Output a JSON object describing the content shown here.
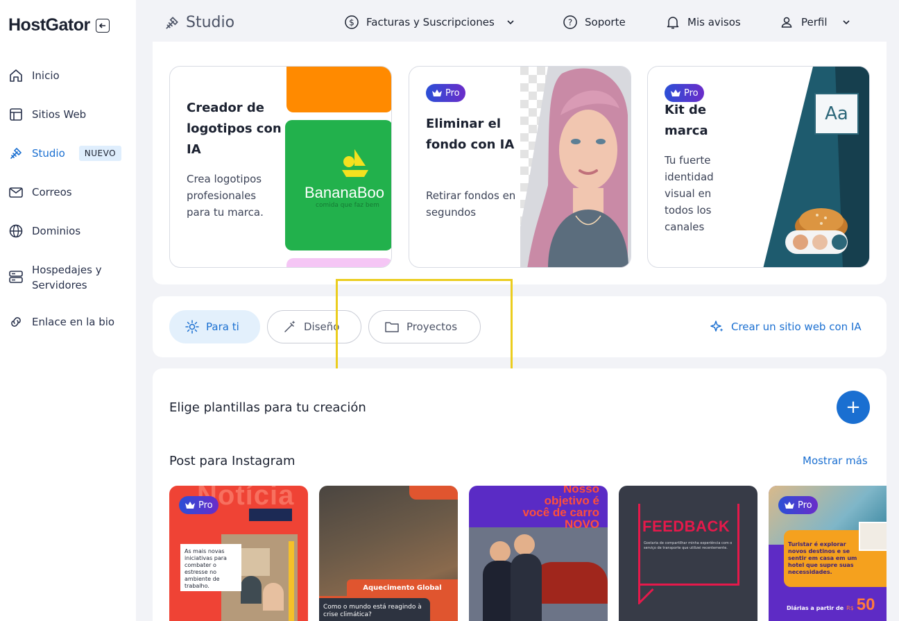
{
  "brand": {
    "logo": "HostGator"
  },
  "sidebar": {
    "items": [
      {
        "label": "Inicio",
        "icon": "home-icon"
      },
      {
        "label": "Sitios Web",
        "icon": "layout-icon"
      },
      {
        "label": "Studio",
        "icon": "studio-icon",
        "badge": "NUEVO",
        "active": true
      },
      {
        "label": "Correos",
        "icon": "mail-icon"
      },
      {
        "label": "Dominios",
        "icon": "globe-icon"
      },
      {
        "label": "Hospedajes y Servidores",
        "icon": "server-icon"
      },
      {
        "label": "Enlace en la bio",
        "icon": "link-icon"
      }
    ]
  },
  "header": {
    "title": "Studio",
    "menu": [
      {
        "label": "Facturas y Suscripciones",
        "icon": "dollar-icon"
      },
      {
        "label": "Soporte",
        "icon": "help-icon"
      },
      {
        "label": "Mis avisos",
        "icon": "bell-icon"
      },
      {
        "label": "Perfil",
        "icon": "user-icon"
      }
    ]
  },
  "cards": [
    {
      "title": "Creador de logotipos con IA",
      "description": "Crea logotipos profesionales para tu marca.",
      "image_text": "BananaBoo",
      "image_subtext": "comida que faz bem"
    },
    {
      "badge": "Pro",
      "title": "Eliminar el fondo con IA",
      "description": "Retirar fondos en segundos"
    },
    {
      "badge": "Pro",
      "title": "Kit de marca",
      "description": "Tu fuerte identidad visual en todos los canales",
      "image_text": "Aa"
    }
  ],
  "tabs": [
    {
      "label": "Para ti",
      "active": true
    },
    {
      "label": "Diseño"
    },
    {
      "label": "Proyectos"
    }
  ],
  "create_link": "Crear un sitio web con IA",
  "templates_section": {
    "title": "Elige plantillas para tu creación",
    "add": "+"
  },
  "instagram": {
    "title": "Post para Instagram",
    "more": "Mostrar más",
    "templates": [
      {
        "badge": "Pro",
        "headline": "Notícia",
        "text": "As mais novas iniciativas para combater o estresse no ambiente de trabalho."
      },
      {
        "headline": "Aquecimento Global",
        "text": "Como o mundo está reagindo à crise climática?"
      },
      {
        "headline": "Nosso objetivo é você de carro NOVO"
      },
      {
        "headline": "FEEDBACK",
        "text": "Gostaria de compartilhar minha experiência com o serviço de transporte que utilizei recentemente."
      },
      {
        "badge": "Pro",
        "text": "Turistar é explorar novos destinos e se sentir em casa em um hotel que supre suas necessidades.",
        "price_label": "Diárias a partir de",
        "currency": "R$",
        "price": "50"
      }
    ]
  },
  "colors": {
    "accent": "#1a6fd1",
    "highlight": "#ebcd1e",
    "pro_start": "#2b4fd6",
    "pro_end": "#6a2cc9"
  }
}
